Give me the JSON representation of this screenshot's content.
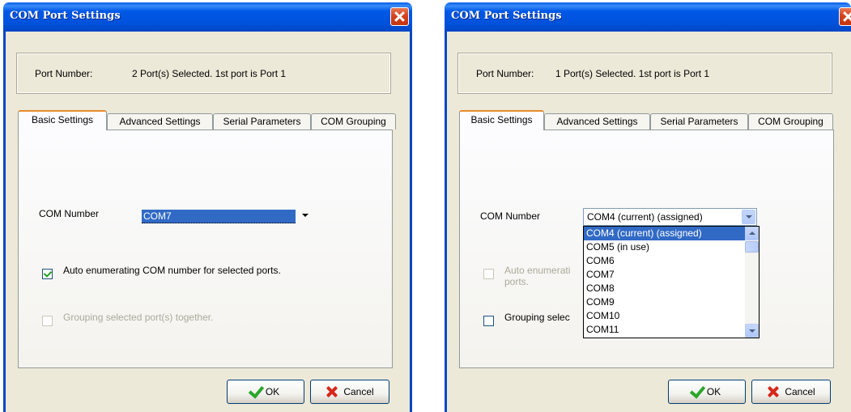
{
  "dialog_left": {
    "title": "COM Port Settings",
    "port_label": "Port Number:",
    "port_value": "2 Port(s) Selected. 1st port is Port 1",
    "tabs": [
      "Basic Settings",
      "Advanced Settings",
      "Serial Parameters",
      "COM Grouping"
    ],
    "active_tab": "Basic Settings",
    "com_label": "COM Number",
    "com_value": "COM7",
    "auto_enum": {
      "label": "Auto enumerating COM number for selected ports.",
      "checked": true,
      "enabled": true
    },
    "grouping": {
      "label": "Grouping selected port(s) together.",
      "checked": false,
      "enabled": false
    },
    "ok_label": "OK",
    "cancel_label": "Cancel"
  },
  "dialog_right": {
    "title": "COM Port Settings",
    "port_label": "Port Number:",
    "port_value": "1 Port(s) Selected. 1st port is Port 1",
    "tabs": [
      "Basic Settings",
      "Advanced Settings",
      "Serial Parameters",
      "COM Grouping"
    ],
    "active_tab": "Basic Settings",
    "com_label": "COM Number",
    "com_value": "COM4 (current) (assigned)",
    "dropdown_items": [
      "COM4 (current) (assigned)",
      "COM5 (in use)",
      "COM6",
      "COM7",
      "COM8",
      "COM9",
      "COM10",
      "COM11"
    ],
    "dropdown_selected": "COM4 (current) (assigned)",
    "auto_enum": {
      "label_visible": "Auto enumerati",
      "label_line2": "ports.",
      "checked": false,
      "enabled": false
    },
    "grouping": {
      "label_visible": "Grouping selec",
      "checked": false,
      "enabled": true
    },
    "ok_label": "OK",
    "cancel_label": "Cancel"
  },
  "colors": {
    "title_bar": "#0054e3",
    "close_button": "#d4431d",
    "dialog_face": "#ece9d8",
    "selection": "#316ac5",
    "active_tab_accent": "#e68b2c"
  },
  "icons": {
    "close": "close-icon",
    "ok": "checkmark-icon",
    "cancel": "x-cancel-icon",
    "combo_arrow": "chevron-down-icon"
  }
}
